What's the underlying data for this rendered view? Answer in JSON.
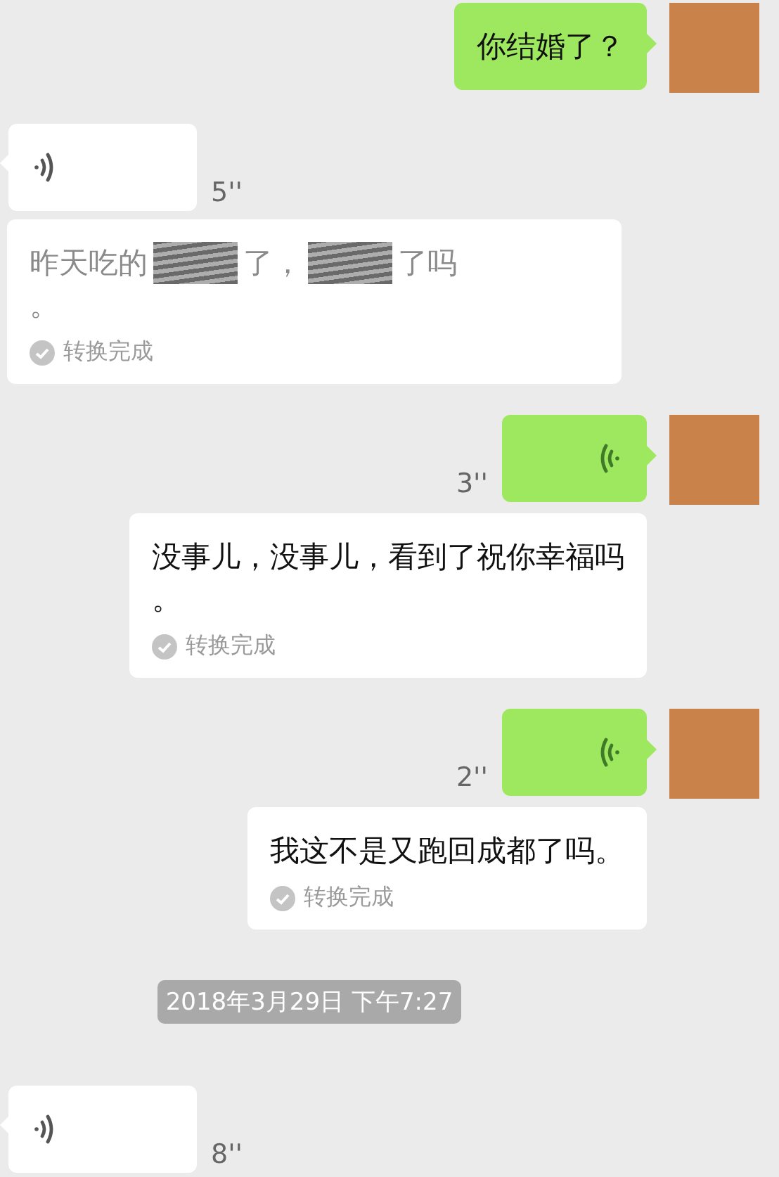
{
  "messages": [
    {
      "kind": "text",
      "outgoing": true,
      "text": "你结婚了？"
    },
    {
      "kind": "voice",
      "outgoing": false,
      "duration": "5''",
      "transcript": {
        "lines": [
          [
            {
              "kind": "text",
              "text": "昨天吃的"
            },
            {
              "kind": "redacted"
            },
            {
              "kind": "text",
              "text": "了，"
            },
            {
              "kind": "redacted"
            },
            {
              "kind": "text",
              "text": "了吗"
            }
          ],
          [
            {
              "kind": "text",
              "text": "。"
            }
          ]
        ],
        "status": "转换完成"
      }
    },
    {
      "kind": "voice",
      "outgoing": true,
      "duration": "3''",
      "transcript": {
        "lines": [
          [
            {
              "kind": "text",
              "text": "没事儿，没事儿，看到了祝你幸福吗"
            }
          ],
          [
            {
              "kind": "text",
              "text": "。"
            }
          ]
        ],
        "status": "转换完成"
      }
    },
    {
      "kind": "voice",
      "outgoing": true,
      "duration": "2''",
      "transcript": {
        "lines": [
          [
            {
              "kind": "text",
              "text": "我这不是又跑回成都了吗。"
            }
          ]
        ],
        "status": "转换完成"
      }
    },
    {
      "kind": "timestamp",
      "text": "2018年3月29日 下午7:27"
    },
    {
      "kind": "voice",
      "outgoing": false,
      "duration": "8''"
    }
  ]
}
